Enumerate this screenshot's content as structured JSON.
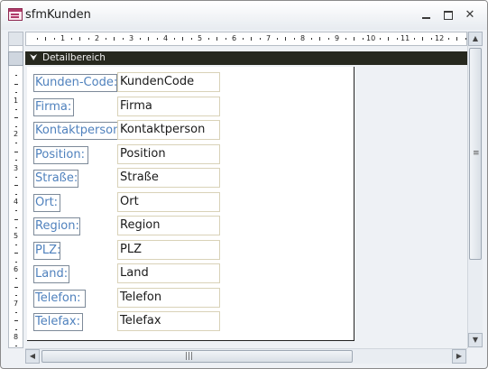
{
  "window": {
    "title": "sfmKunden",
    "controls": {
      "minimize": "minimize",
      "maximize": "maximize",
      "close": "✕"
    }
  },
  "ruler": {
    "horizontal_numbers": [
      "1",
      "2",
      "3",
      "4",
      "5",
      "6",
      "7",
      "8",
      "9",
      "10",
      "11",
      "12"
    ],
    "vertical_numbers": [
      "1",
      "2",
      "3",
      "4",
      "5",
      "6",
      "7",
      "8"
    ]
  },
  "section": {
    "glyph": "⮟",
    "label": "Detailbereich"
  },
  "fields": [
    {
      "label": "Kunden-Code:",
      "value": "KundenCode"
    },
    {
      "label": "Firma:",
      "value": "Firma"
    },
    {
      "label": "Kontaktperson:",
      "value": "Kontaktperson"
    },
    {
      "label": "Position:",
      "value": "Position"
    },
    {
      "label": "Straße:",
      "value": "Straße"
    },
    {
      "label": "Ort:",
      "value": "Ort"
    },
    {
      "label": "Region:",
      "value": "Region"
    },
    {
      "label": "PLZ:",
      "value": "PLZ"
    },
    {
      "label": "Land:",
      "value": "Land"
    },
    {
      "label": "Telefon:",
      "value": "Telefon"
    },
    {
      "label": "Telefax:",
      "value": "Telefax"
    }
  ],
  "scrollbars": {
    "up": "▲",
    "down": "▼",
    "left": "◀",
    "right": "▶",
    "grip_v": "≡",
    "grip_h": "|||"
  },
  "colors": {
    "label_text": "#4f81bd",
    "section_bar": "#27291f",
    "textbox_border": "#d9d2b8"
  }
}
